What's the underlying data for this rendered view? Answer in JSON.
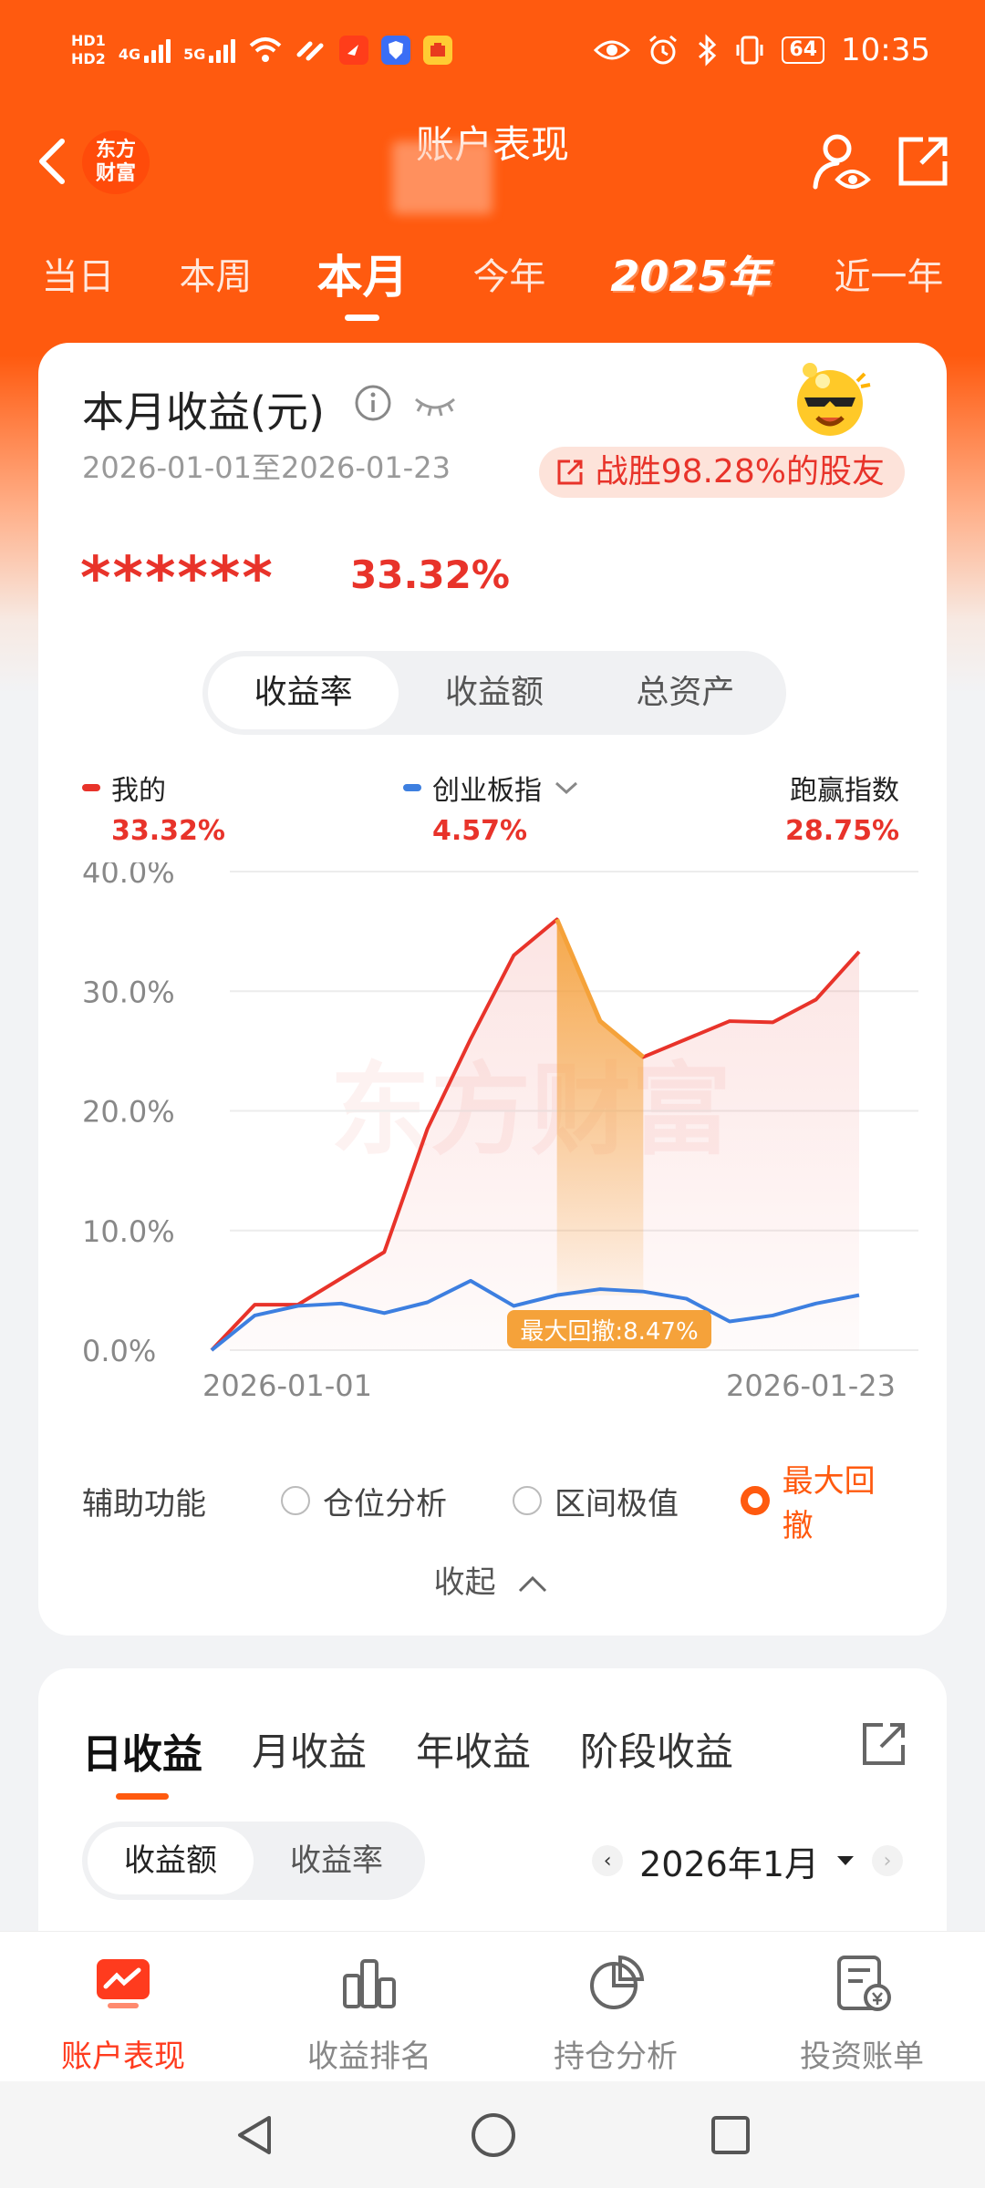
{
  "status_bar": {
    "time": "10:35",
    "battery": "64",
    "network_labels": [
      "HD1",
      "HD2",
      "4G",
      "5G"
    ]
  },
  "header": {
    "title": "账户表现",
    "brand_logo_text": [
      "东方",
      "财富"
    ],
    "icons": [
      "back-arrow-icon",
      "user-eye-icon",
      "share-icon"
    ]
  },
  "period_tabs": [
    {
      "label": "当日",
      "active": false
    },
    {
      "label": "本周",
      "active": false
    },
    {
      "label": "本月",
      "active": true
    },
    {
      "label": "今年",
      "active": false
    },
    {
      "label": "2025年",
      "active": false
    },
    {
      "label": "近一年",
      "active": false
    }
  ],
  "summary": {
    "title": "本月收益(元)",
    "date_range": "2026-01-01至2026-01-23",
    "beat_text": "战胜98.28%的股友",
    "masked_amount": "******",
    "return_pct": "33.32%"
  },
  "metric_tabs": [
    {
      "label": "收益率",
      "active": true
    },
    {
      "label": "收益额",
      "active": false
    },
    {
      "label": "总资产",
      "active": false
    }
  ],
  "legend": {
    "mine": {
      "name": "我的",
      "value": "33.32%",
      "color": "#e8332a"
    },
    "index": {
      "name": "创业板指",
      "value": "4.57%",
      "color": "#3d7fe0"
    },
    "excess": {
      "name": "跑赢指数",
      "value": "28.75%"
    }
  },
  "chart_data": {
    "type": "line",
    "title": "",
    "xlabel": "",
    "ylabel": "",
    "ylim": [
      0,
      40
    ],
    "y_ticks": [
      "40.0%",
      "30.0%",
      "20.0%",
      "10.0%",
      "0.0%"
    ],
    "x_tick_labels": [
      "2026-01-01",
      "2026-01-23"
    ],
    "x": [
      "2026-01-01",
      "2026-01-02",
      "2026-01-05",
      "2026-01-06",
      "2026-01-07",
      "2026-01-08",
      "2026-01-09",
      "2026-01-12",
      "2026-01-13",
      "2026-01-14",
      "2026-01-15",
      "2026-01-16",
      "2026-01-19",
      "2026-01-20",
      "2026-01-21",
      "2026-01-22",
      "2026-01-23"
    ],
    "series": [
      {
        "name": "我的",
        "color": "#e8332a",
        "values": [
          0.0,
          3.8,
          3.8,
          6.0,
          8.2,
          18.5,
          26.0,
          33.0,
          36.0,
          27.5,
          24.5,
          26.0,
          27.5,
          27.4,
          29.3,
          33.3
        ]
      },
      {
        "name": "创业板指",
        "color": "#3d7fe0",
        "values": [
          0.0,
          2.9,
          3.7,
          3.9,
          3.1,
          4.0,
          5.8,
          3.7,
          4.6,
          5.1,
          4.9,
          4.3,
          2.4,
          2.9,
          3.9,
          4.6
        ]
      }
    ],
    "drawdown": {
      "label": "最大回撤:8.47%",
      "from_index": 8,
      "to_index": 10,
      "color": "#f5a23a"
    },
    "watermark": "东方财富",
    "grid": true
  },
  "aux": {
    "label": "辅助功能",
    "options": [
      {
        "label": "仓位分析",
        "checked": false
      },
      {
        "label": "区间极值",
        "checked": false
      },
      {
        "label": "最大回撤",
        "checked": true
      }
    ],
    "collapse_label": "收起"
  },
  "daily": {
    "tabs": [
      {
        "label": "日收益",
        "active": true
      },
      {
        "label": "月收益",
        "active": false
      },
      {
        "label": "年收益",
        "active": false
      },
      {
        "label": "阶段收益",
        "active": false
      }
    ],
    "segments": [
      {
        "label": "收益额",
        "active": true
      },
      {
        "label": "收益率",
        "active": false
      }
    ],
    "month": "2026年1月"
  },
  "bottom_nav": [
    {
      "label": "账户表现",
      "icon": "trend-chart-icon",
      "active": true
    },
    {
      "label": "收益排名",
      "icon": "bar-rank-icon",
      "active": false
    },
    {
      "label": "持仓分析",
      "icon": "pie-chart-icon",
      "active": false
    },
    {
      "label": "投资账单",
      "icon": "bill-icon",
      "active": false
    }
  ],
  "colors": {
    "brand_orange": "#ff5a0f",
    "up_red": "#e8332a",
    "index_blue": "#3d7fe0",
    "drawdown_orange": "#f5a23a"
  }
}
